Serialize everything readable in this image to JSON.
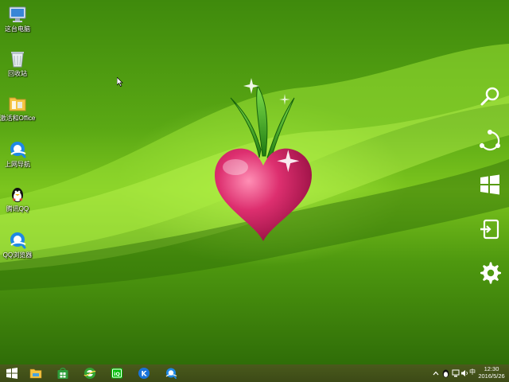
{
  "desktop": {
    "icons": [
      {
        "label": "这台电脑",
        "icon": "computer-icon"
      },
      {
        "label": "回收站",
        "icon": "recycle-bin-icon"
      },
      {
        "label": "激活和Office",
        "icon": "folder-icon"
      },
      {
        "label": "上网导航",
        "icon": "qq-browser-icon"
      },
      {
        "label": "腾讯QQ",
        "icon": "qq-penguin-icon"
      },
      {
        "label": "QQ浏览器",
        "icon": "qq-browser-icon"
      }
    ]
  },
  "charms": [
    "search-icon",
    "share-icon",
    "windows-start-icon",
    "devices-icon",
    "settings-gear-icon"
  ],
  "taskbar": {
    "apps": [
      "start-icon",
      "file-explorer-icon",
      "store-icon",
      "ie-browser-icon",
      "iqiyi-icon",
      "kugou-icon",
      "qq-browser-icon"
    ],
    "tray": {
      "input_method": "中",
      "time": "12:30",
      "date": "2016/5/26"
    }
  },
  "colors": {
    "wallpaper_green": "#5aa814",
    "radish_pink": "#d9306f",
    "leaf_green": "#3fa21a",
    "taskbar": "#3c4a16"
  }
}
